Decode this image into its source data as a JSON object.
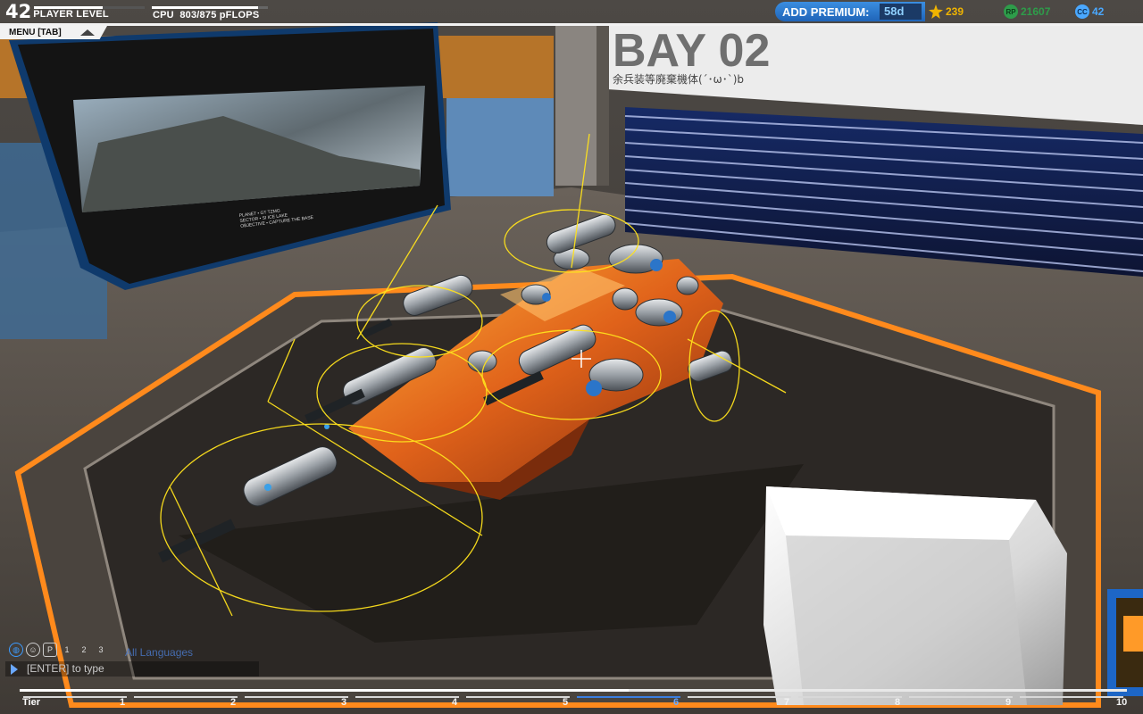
{
  "hud": {
    "player_level": "42",
    "player_level_label": "PLAYER LEVEL",
    "player_level_progress": 0.62,
    "cpu_label": "CPU",
    "cpu_value": "803/875 pFLOPS",
    "cpu_progress": 0.918,
    "menu_label": "MENU [TAB]"
  },
  "premium": {
    "label": "ADD PREMIUM:",
    "value": "58d"
  },
  "currencies": [
    {
      "name": "robits",
      "icon": "star-icon",
      "value": "239",
      "color": "#f0b400"
    },
    {
      "name": "rp",
      "icon": "rp-icon",
      "icon_text": "RP",
      "value": "21607",
      "color": "#2e9c4a"
    },
    {
      "name": "cc",
      "icon": "cc-icon",
      "icon_text": "CC",
      "value": "42",
      "color": "#4aa8ff"
    }
  ],
  "scene": {
    "bay_title": "BAY 02",
    "bay_subtitle": "余兵装等廃棄機体(´･ω･`)b",
    "planet_caption": "PLANET • GT TZMG\nSECTOR • SI ICE LAKE\nOBJECTIVE • CAPTURE THE BASE"
  },
  "chat": {
    "language_filter": "All Languages",
    "input_placeholder": "[ENTER] to type",
    "icons": [
      "globe-icon",
      "person-icon",
      "p-icon",
      "party-1-icon",
      "party-2-icon",
      "party-3-icon"
    ]
  },
  "tier_bar": {
    "tier_label": "Tier",
    "tiers": [
      "1",
      "2",
      "3",
      "4",
      "5",
      "6",
      "7",
      "8",
      "9",
      "10"
    ],
    "active_tier": "6",
    "progress": 0.55
  }
}
